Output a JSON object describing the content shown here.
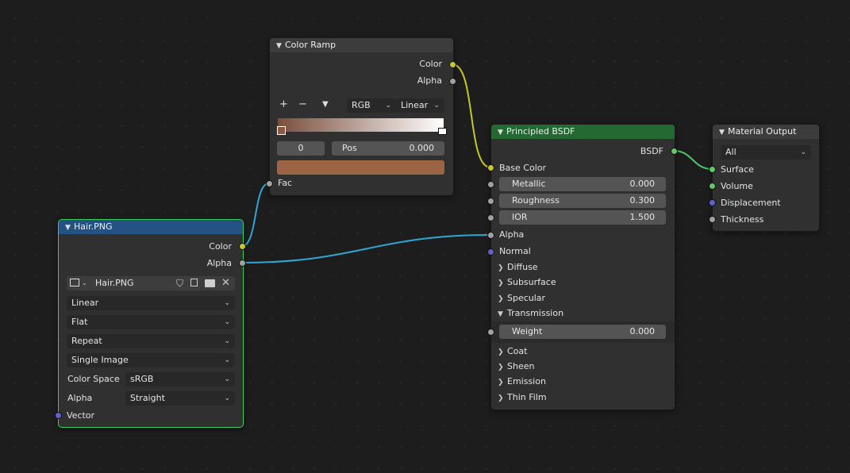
{
  "color_ramp": {
    "title": "Color Ramp",
    "out_color": "Color",
    "out_alpha": "Alpha",
    "add_icon": "+",
    "remove_icon": "−",
    "mode": "RGB",
    "interpolation": "Linear",
    "stop_index": "0",
    "pos_label": "Pos",
    "pos_value": "0.000",
    "stop_color": "#9b6543",
    "gradient_start": "#7a4e3c",
    "gradient_end": "#ffffff",
    "in_fac": "Fac"
  },
  "image_texture": {
    "title": "Hair.PNG",
    "header_color": "#245283",
    "out_color": "Color",
    "out_alpha": "Alpha",
    "image_name": "Hair.PNG",
    "interpolation": "Linear",
    "projection": "Flat",
    "extension": "Repeat",
    "source": "Single Image",
    "color_space_label": "Color Space",
    "color_space": "sRGB",
    "alpha_label": "Alpha",
    "alpha_mode": "Straight",
    "in_vector": "Vector"
  },
  "principled": {
    "title": "Principled BSDF",
    "header_color": "#246932",
    "out_bsdf": "BSDF",
    "base_color": "Base Color",
    "metallic_label": "Metallic",
    "metallic": "0.000",
    "metallic_fill": 0,
    "roughness_label": "Roughness",
    "roughness": "0.300",
    "roughness_fill": 0.3,
    "ior_label": "IOR",
    "ior": "1.500",
    "alpha": "Alpha",
    "normal": "Normal",
    "diffuse": "Diffuse",
    "subsurface": "Subsurface",
    "specular": "Specular",
    "transmission": "Transmission",
    "weight_label": "Weight",
    "weight": "0.000",
    "coat": "Coat",
    "sheen": "Sheen",
    "emission": "Emission",
    "thin_film": "Thin Film"
  },
  "material_output": {
    "title": "Material Output",
    "target": "All",
    "surface": "Surface",
    "volume": "Volume",
    "displacement": "Displacement",
    "thickness": "Thickness"
  },
  "link_colors": {
    "color": "#c7c729",
    "float": "#2fa7d4",
    "shader": "#4cc76a"
  }
}
